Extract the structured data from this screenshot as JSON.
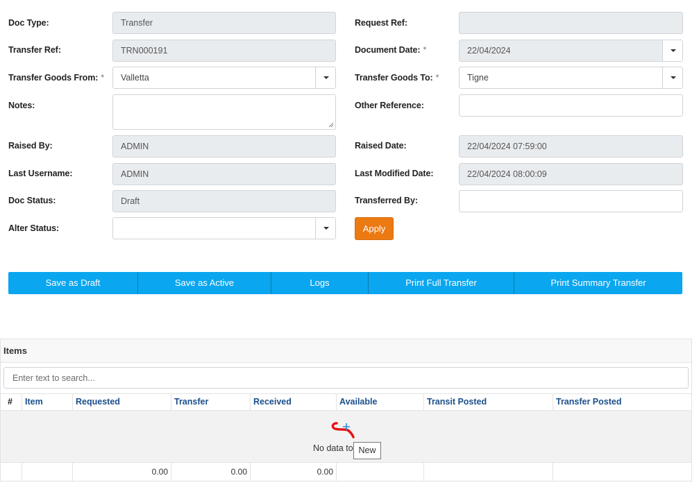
{
  "form": {
    "doc_type": {
      "label": "Doc Type:",
      "value": "Transfer"
    },
    "transfer_ref": {
      "label": "Transfer Ref:",
      "value": "TRN000191"
    },
    "transfer_goods_from": {
      "label": "Transfer Goods From:",
      "required": "*",
      "value": "Valletta"
    },
    "notes": {
      "label": "Notes:",
      "value": ""
    },
    "raised_by": {
      "label": "Raised By:",
      "value": "ADMIN"
    },
    "last_username": {
      "label": "Last Username:",
      "value": "ADMIN"
    },
    "doc_status": {
      "label": "Doc Status:",
      "value": "Draft"
    },
    "alter_status": {
      "label": "Alter Status:",
      "value": ""
    },
    "request_ref": {
      "label": "Request Ref:",
      "value": ""
    },
    "document_date": {
      "label": "Document Date:",
      "required": "*",
      "value": "22/04/2024"
    },
    "transfer_goods_to": {
      "label": "Transfer Goods To:",
      "required": "*",
      "value": "Tigne"
    },
    "other_reference": {
      "label": "Other Reference:",
      "value": ""
    },
    "raised_date": {
      "label": "Raised Date:",
      "value": "22/04/2024 07:59:00"
    },
    "last_modified_date": {
      "label": "Last Modified Date:",
      "value": "22/04/2024 08:00:09"
    },
    "transferred_by": {
      "label": "Transferred By:",
      "value": ""
    },
    "apply_label": "Apply"
  },
  "toolbar": {
    "save_draft": "Save as Draft",
    "save_active": "Save as Active",
    "logs": "Logs",
    "print_full": "Print Full Transfer",
    "print_summary": "Print Summary Transfer"
  },
  "items": {
    "title": "Items",
    "search_placeholder": "Enter text to search...",
    "columns": [
      "#",
      "Item",
      "Requested",
      "Transfer",
      "Received",
      "Available",
      "Transit Posted",
      "Transfer Posted"
    ],
    "no_data_text": "No data to",
    "totals": {
      "requested": "0.00",
      "transfer": "0.00",
      "received": "0.00"
    },
    "tooltip": "New"
  },
  "colors": {
    "toolbar": "#0aa6f0",
    "apply": "#ec7a13",
    "header_text": "#1a4f8b"
  }
}
